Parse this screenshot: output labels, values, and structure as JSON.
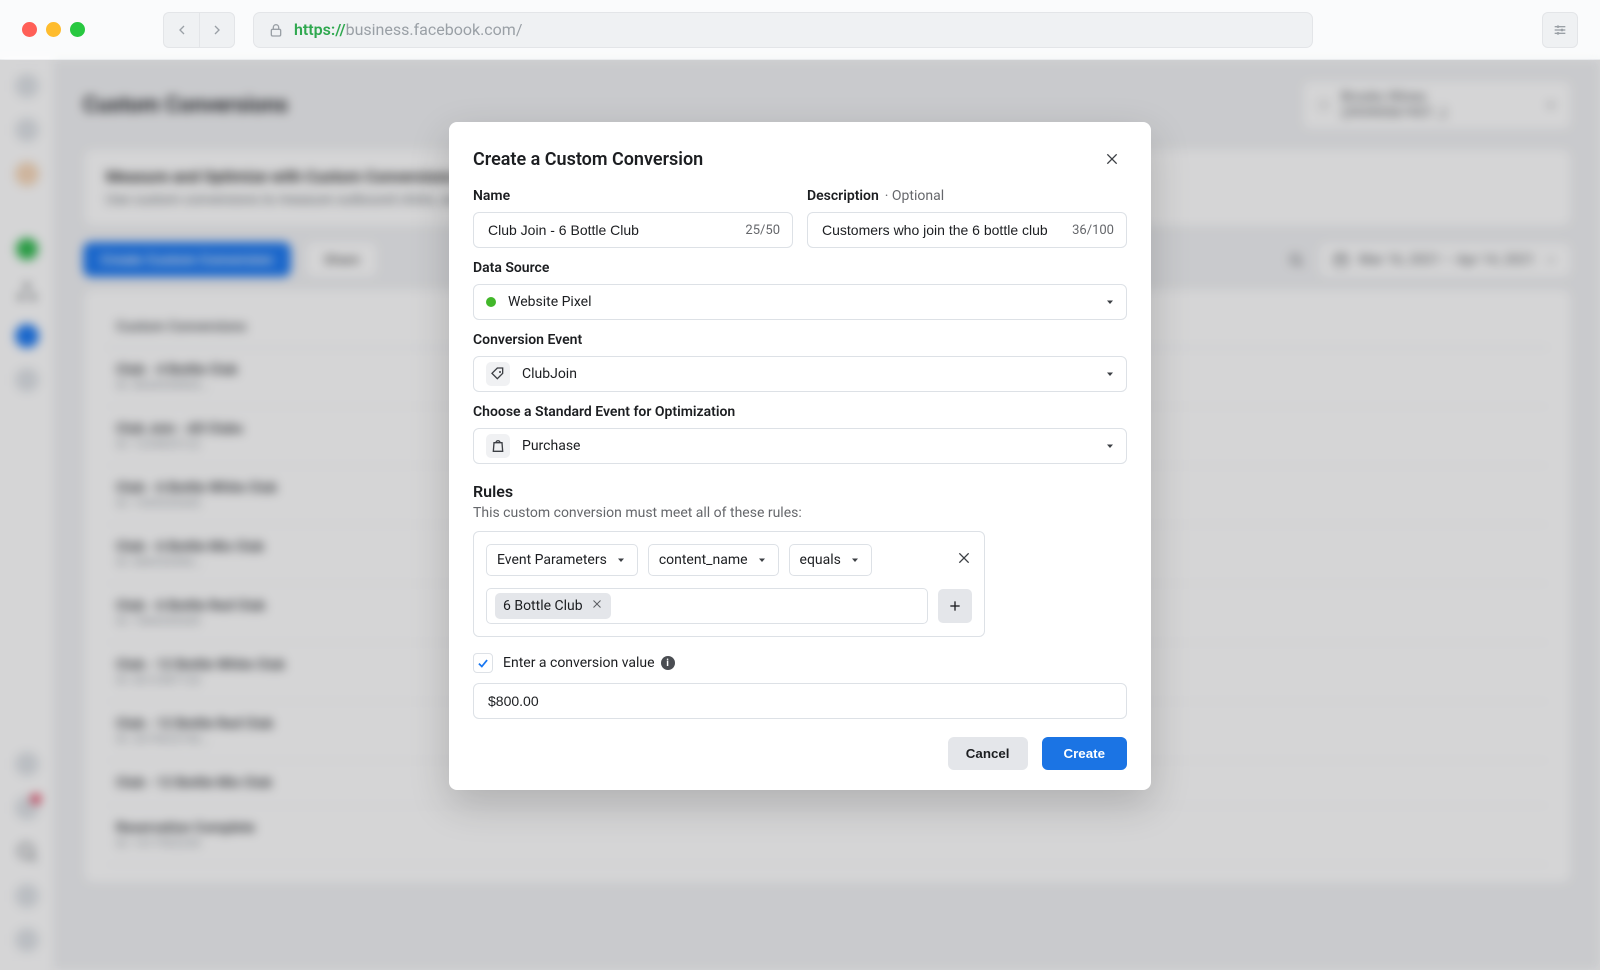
{
  "browser": {
    "protocol": "https://",
    "host": "business.facebook.com/"
  },
  "page": {
    "title": "Custom Conversions",
    "account_name": "Brooks Wines (39390567457…)",
    "info_title": "Measure and Optimize with Custom Conversions",
    "info_body": "Use custom conversions to measure outbound clicks, and optimize your ads for URL traffic at…",
    "btn_create": "Create Custom Conversion",
    "btn_share": "Share",
    "date_range": "Mar 16, 2021 – Apr 14, 2021",
    "table_col1": "Custom Conversions",
    "rows": [
      {
        "name": "Club - 4 Bottle Club",
        "id": "ID: 8026949854..."
      },
      {
        "name": "Club Join - All Clubs",
        "id": "ID: 1234829122"
      },
      {
        "name": "Club - 6 Bottle White Club",
        "id": "ID: 1459335445"
      },
      {
        "name": "Club - 6 Bottle Mix Club",
        "id": "ID: 686926984..."
      },
      {
        "name": "Club - 6 Bottle Red Club",
        "id": "ID: 7084349449"
      },
      {
        "name": "Club - 12 Bottle White Club",
        "id": "ID: 6012987120"
      },
      {
        "name": "Club - 12 Bottle Red Club",
        "id": "ID: 2079623740..."
      },
      {
        "name": "Club - 12 Bottle Mix Club",
        "id": ""
      },
      {
        "name": "Reservation Complete",
        "id": "ID: 1417902244"
      }
    ]
  },
  "modal": {
    "title": "Create a Custom Conversion",
    "name_label": "Name",
    "name_value": "Club Join - 6 Bottle Club",
    "name_counter": "25/50",
    "desc_label": "Description",
    "desc_optional": "· Optional",
    "desc_value": "Customers who join the 6 bottle club",
    "desc_counter": "36/100",
    "data_source_label": "Data Source",
    "data_source_value": "Website Pixel",
    "conversion_event_label": "Conversion Event",
    "conversion_event_value": "ClubJoin",
    "standard_event_label": "Choose a Standard Event for Optimization",
    "standard_event_value": "Purchase",
    "rules_label": "Rules",
    "rules_sub": "This custom conversion must meet all of these rules:",
    "rule_param_type": "Event Parameters",
    "rule_param_key": "content_name",
    "rule_operator": "equals",
    "rule_value_chip": "6 Bottle Club",
    "cv_checkbox_label": "Enter a conversion value",
    "cv_checked": true,
    "cv_value": "$800.00",
    "btn_cancel": "Cancel",
    "btn_create": "Create"
  }
}
